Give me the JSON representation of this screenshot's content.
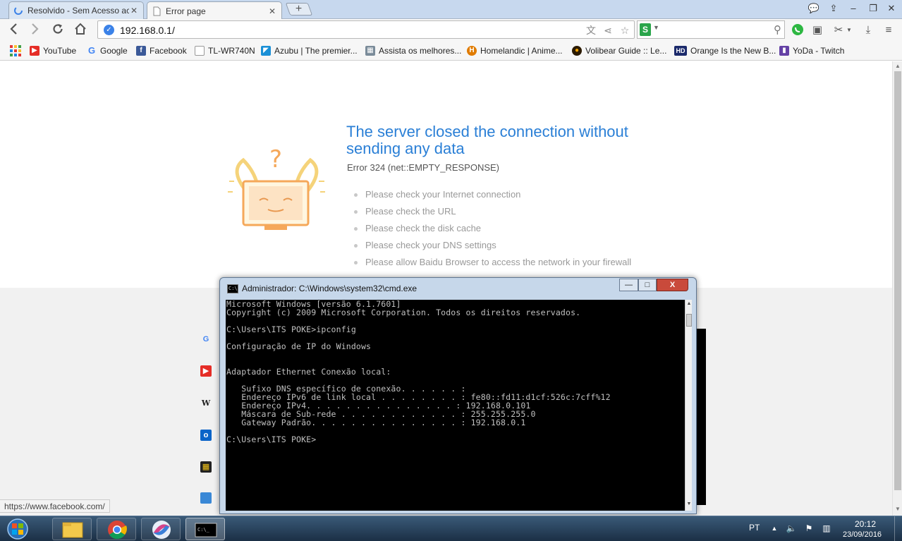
{
  "browser": {
    "tabs": [
      {
        "title": "Resolvido - Sem Acesso ac"
      },
      {
        "title": "Error page"
      }
    ],
    "new_tab_label": "+",
    "url": "192.168.0.1/",
    "search_engine_letter": "S",
    "bookmarks": [
      {
        "label": "YouTube"
      },
      {
        "label": "Google"
      },
      {
        "label": "Facebook"
      },
      {
        "label": "TL-WR740N"
      },
      {
        "label": "Azubu | The premier..."
      },
      {
        "label": "Assista os melhores..."
      },
      {
        "label": "Homelandic | Anime..."
      },
      {
        "label": "Volibear Guide :: Le..."
      },
      {
        "label": "Orange Is the New B..."
      },
      {
        "label": "YoDa - Twitch"
      }
    ]
  },
  "error_page": {
    "title": "The server closed the connection without sending any data",
    "code": "Error 324 (net::EMPTY_RESPONSE)",
    "suggestions": [
      "Please check your Internet connection",
      "Please check the URL",
      "Please check the disk cache",
      "Please check your DNS settings",
      "Please allow Baidu Browser to access the network in your firewall"
    ]
  },
  "status_bar_url": "https://www.facebook.com/",
  "cmd_window": {
    "title": "Administrador: C:\\Windows\\system32\\cmd.exe",
    "icon_text": "C:\\",
    "minimize_label": "—",
    "maximize_label": "□",
    "close_label": "X",
    "lines": [
      "Microsoft Windows [versão 6.1.7601]",
      "Copyright (c) 2009 Microsoft Corporation. Todos os direitos reservados.",
      "",
      "C:\\Users\\ITS POKE>ipconfig",
      "",
      "Configuração de IP do Windows",
      "",
      "",
      "Adaptador Ethernet Conexão local:",
      "",
      "   Sufixo DNS específico de conexão. . . . . . :",
      "   Endereço IPv6 de link local . . . . . . . . : fe80::fd11:d1cf:526c:7cff%12",
      "   Endereço IPv4. . . . . . . . . . . . . . . : 192.168.0.101",
      "   Máscara de Sub-rede . . . . . . . . . . . . : 255.255.255.0",
      "   Gateway Padrão. . . . . . . . . . . . . . . : 192.168.0.1",
      "",
      "C:\\Users\\ITS POKE>"
    ]
  },
  "taskbar": {
    "language": "PT",
    "time": "20:12",
    "date": "23/09/2016"
  },
  "colors": {
    "error_title": "#2a7fd6",
    "console_bg": "#000000",
    "console_text": "#c0c0c0"
  }
}
